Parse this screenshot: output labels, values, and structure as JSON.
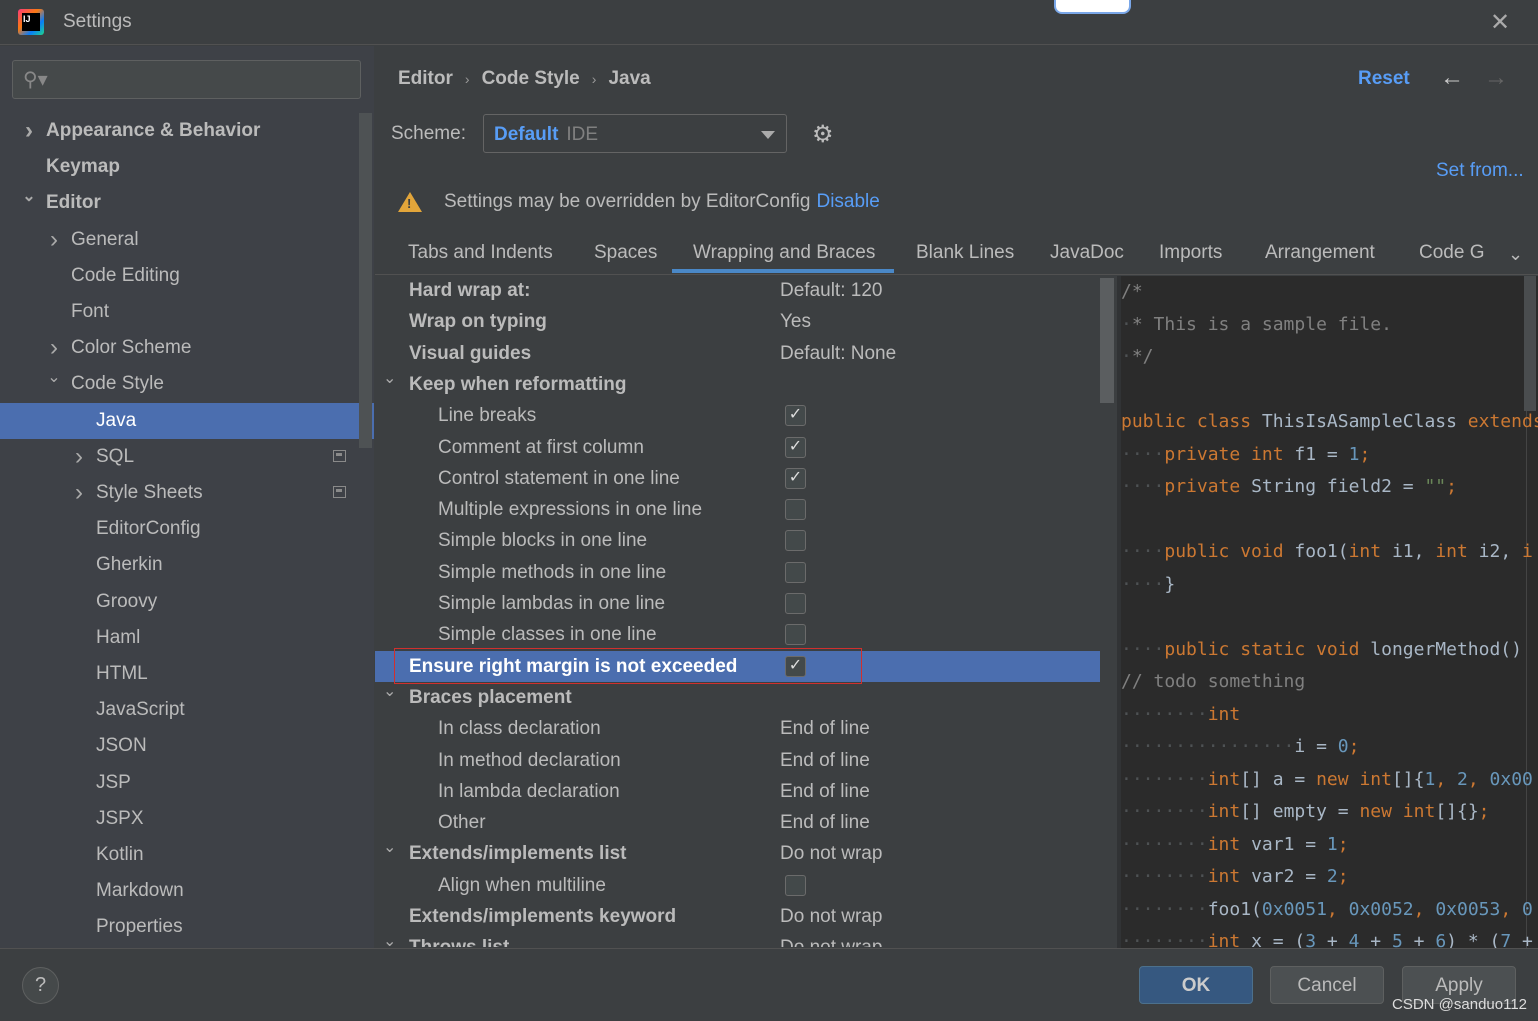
{
  "window": {
    "title": "Settings",
    "close_icon": "close-icon",
    "logo_text": "IJ"
  },
  "search": {
    "placeholder": "",
    "icon": "search-icon"
  },
  "sidebar": {
    "items": [
      {
        "label": "Appearance & Behavior",
        "level": 0,
        "bold": true,
        "expander": "collapsed"
      },
      {
        "label": "Keymap",
        "level": 0,
        "bold": true,
        "expander": "none"
      },
      {
        "label": "Editor",
        "level": 0,
        "bold": true,
        "expander": "expanded"
      },
      {
        "label": "General",
        "level": 1,
        "expander": "collapsed"
      },
      {
        "label": "Code Editing",
        "level": 1,
        "expander": "none"
      },
      {
        "label": "Font",
        "level": 1,
        "expander": "none"
      },
      {
        "label": "Color Scheme",
        "level": 1,
        "expander": "collapsed"
      },
      {
        "label": "Code Style",
        "level": 1,
        "expander": "expanded"
      },
      {
        "label": "Java",
        "level": 2,
        "expander": "none",
        "selected": true
      },
      {
        "label": "SQL",
        "level": 2,
        "expander": "collapsed",
        "project_icon": true
      },
      {
        "label": "Style Sheets",
        "level": 2,
        "expander": "collapsed",
        "project_icon": true
      },
      {
        "label": "EditorConfig",
        "level": 2,
        "expander": "none"
      },
      {
        "label": "Gherkin",
        "level": 2,
        "expander": "none"
      },
      {
        "label": "Groovy",
        "level": 2,
        "expander": "none"
      },
      {
        "label": "Haml",
        "level": 2,
        "expander": "none"
      },
      {
        "label": "HTML",
        "level": 2,
        "expander": "none"
      },
      {
        "label": "JavaScript",
        "level": 2,
        "expander": "none"
      },
      {
        "label": "JSON",
        "level": 2,
        "expander": "none"
      },
      {
        "label": "JSP",
        "level": 2,
        "expander": "none"
      },
      {
        "label": "JSPX",
        "level": 2,
        "expander": "none"
      },
      {
        "label": "Kotlin",
        "level": 2,
        "expander": "none"
      },
      {
        "label": "Markdown",
        "level": 2,
        "expander": "none"
      },
      {
        "label": "Properties",
        "level": 2,
        "expander": "none"
      }
    ]
  },
  "header": {
    "breadcrumb": [
      "Editor",
      "Code Style",
      "Java"
    ],
    "reset": "Reset",
    "back_icon": "arrow-left-icon",
    "forward_icon": "arrow-right-icon"
  },
  "scheme": {
    "label": "Scheme:",
    "value": "Default",
    "scope": "IDE",
    "set_from": "Set from..."
  },
  "notice": {
    "text": "Settings may be overridden by EditorConfig",
    "link": "Disable"
  },
  "tabs": [
    {
      "label": "Tabs and Indents"
    },
    {
      "label": "Spaces"
    },
    {
      "label": "Wrapping and Braces",
      "active": true
    },
    {
      "label": "Blank Lines"
    },
    {
      "label": "JavaDoc"
    },
    {
      "label": "Imports"
    },
    {
      "label": "Arrangement"
    },
    {
      "label": "Code G"
    }
  ],
  "options": [
    {
      "label": "Hard wrap at:",
      "bold": true,
      "value": "Default: 120"
    },
    {
      "label": "Wrap on typing",
      "bold": true,
      "value": "Yes"
    },
    {
      "label": "Visual guides",
      "bold": true,
      "value": "Default: None"
    },
    {
      "label": "Keep when reformatting",
      "bold": true,
      "group": true
    },
    {
      "label": "Line breaks",
      "indent": true,
      "checked": true
    },
    {
      "label": "Comment at first column",
      "indent": true,
      "checked": true
    },
    {
      "label": "Control statement in one line",
      "indent": true,
      "checked": true
    },
    {
      "label": "Multiple expressions in one line",
      "indent": true,
      "checked": false
    },
    {
      "label": "Simple blocks in one line",
      "indent": true,
      "checked": false
    },
    {
      "label": "Simple methods in one line",
      "indent": true,
      "checked": false
    },
    {
      "label": "Simple lambdas in one line",
      "indent": true,
      "checked": false
    },
    {
      "label": "Simple classes in one line",
      "indent": true,
      "checked": false
    },
    {
      "label": "Ensure right margin is not exceeded",
      "bold": true,
      "checked": true,
      "selected": true
    },
    {
      "label": "Braces placement",
      "bold": true,
      "group": true
    },
    {
      "label": "In class declaration",
      "indent": true,
      "value": "End of line"
    },
    {
      "label": "In method declaration",
      "indent": true,
      "value": "End of line"
    },
    {
      "label": "In lambda declaration",
      "indent": true,
      "value": "End of line"
    },
    {
      "label": "Other",
      "indent": true,
      "value": "End of line"
    },
    {
      "label": "Extends/implements list",
      "bold": true,
      "group": true,
      "value": "Do not wrap"
    },
    {
      "label": "Align when multiline",
      "indent": true,
      "checked": false
    },
    {
      "label": "Extends/implements keyword",
      "bold": true,
      "value": "Do not wrap"
    },
    {
      "label": "Throws list",
      "bold": true,
      "group": true,
      "value": "Do not wrap"
    }
  ],
  "code_preview": [
    [
      [
        "/*",
        "c"
      ]
    ],
    [
      [
        "·",
        "w"
      ],
      [
        "* This is a sample file.",
        "c"
      ]
    ],
    [
      [
        "·",
        "w"
      ],
      [
        "*/",
        "c"
      ]
    ],
    [],
    [
      [
        "public class ",
        "k"
      ],
      [
        "ThisIsASampleClass ",
        "p"
      ],
      [
        "extends",
        "k"
      ]
    ],
    [
      [
        "····",
        "w"
      ],
      [
        "private int ",
        "k"
      ],
      [
        "f1 = ",
        "p"
      ],
      [
        "1",
        "n"
      ],
      [
        ";",
        "k"
      ]
    ],
    [
      [
        "····",
        "w"
      ],
      [
        "private ",
        "k"
      ],
      [
        "String field2 = ",
        "p"
      ],
      [
        "\"\"",
        "s"
      ],
      [
        ";",
        "k"
      ]
    ],
    [],
    [
      [
        "····",
        "w"
      ],
      [
        "public void ",
        "k"
      ],
      [
        "foo1(",
        "p"
      ],
      [
        "int ",
        "k"
      ],
      [
        "i1, ",
        "p"
      ],
      [
        "int ",
        "k"
      ],
      [
        "i2, ",
        "p"
      ],
      [
        "i",
        "k"
      ]
    ],
    [
      [
        "····",
        "w"
      ],
      [
        "}",
        "p"
      ]
    ],
    [],
    [
      [
        "····",
        "w"
      ],
      [
        "public static void ",
        "k"
      ],
      [
        "longerMethod()",
        "p"
      ]
    ],
    [
      [
        "// todo something",
        "c"
      ]
    ],
    [
      [
        "········",
        "w"
      ],
      [
        "int",
        "k"
      ]
    ],
    [
      [
        "················",
        "w"
      ],
      [
        "i = ",
        "p"
      ],
      [
        "0",
        "n"
      ],
      [
        ";",
        "k"
      ]
    ],
    [
      [
        "········",
        "w"
      ],
      [
        "int",
        "k"
      ],
      [
        "[] a = ",
        "p"
      ],
      [
        "new ",
        "k"
      ],
      [
        "int",
        "k"
      ],
      [
        "[]{",
        "p"
      ],
      [
        "1",
        "n"
      ],
      [
        ", ",
        "k"
      ],
      [
        "2",
        "n"
      ],
      [
        ", ",
        "k"
      ],
      [
        "0x00",
        "n"
      ]
    ],
    [
      [
        "········",
        "w"
      ],
      [
        "int",
        "k"
      ],
      [
        "[] empty = ",
        "p"
      ],
      [
        "new ",
        "k"
      ],
      [
        "int",
        "k"
      ],
      [
        "[]{}",
        "p"
      ],
      [
        ";",
        "k"
      ]
    ],
    [
      [
        "········",
        "w"
      ],
      [
        "int ",
        "k"
      ],
      [
        "var1 = ",
        "p"
      ],
      [
        "1",
        "n"
      ],
      [
        ";",
        "k"
      ]
    ],
    [
      [
        "········",
        "w"
      ],
      [
        "int ",
        "k"
      ],
      [
        "var2 = ",
        "p"
      ],
      [
        "2",
        "n"
      ],
      [
        ";",
        "k"
      ]
    ],
    [
      [
        "········",
        "w"
      ],
      [
        "foo1(",
        "p"
      ],
      [
        "0x0051",
        "n"
      ],
      [
        ", ",
        "k"
      ],
      [
        "0x0052",
        "n"
      ],
      [
        ", ",
        "k"
      ],
      [
        "0x0053",
        "n"
      ],
      [
        ", ",
        "k"
      ],
      [
        "0",
        "n"
      ]
    ],
    [
      [
        "········",
        "w"
      ],
      [
        "int ",
        "k"
      ],
      [
        "x = (",
        "p"
      ],
      [
        "3",
        "n"
      ],
      [
        " + ",
        "p"
      ],
      [
        "4",
        "n"
      ],
      [
        " + ",
        "p"
      ],
      [
        "5",
        "n"
      ],
      [
        " + ",
        "p"
      ],
      [
        "6",
        "n"
      ],
      [
        ") * (",
        "p"
      ],
      [
        "7",
        "n"
      ],
      [
        " +",
        "p"
      ]
    ]
  ],
  "footer": {
    "help": "?",
    "ok": "OK",
    "cancel": "Cancel",
    "apply": "Apply"
  },
  "watermark": "CSDN @sanduo112",
  "colors": {
    "accent": "#589df6",
    "selection": "#4b6eaf",
    "keyword": "#cc7832",
    "number": "#6897bb",
    "comment": "#808080",
    "string": "#6a8759",
    "highlight_box": "#d0302e"
  }
}
